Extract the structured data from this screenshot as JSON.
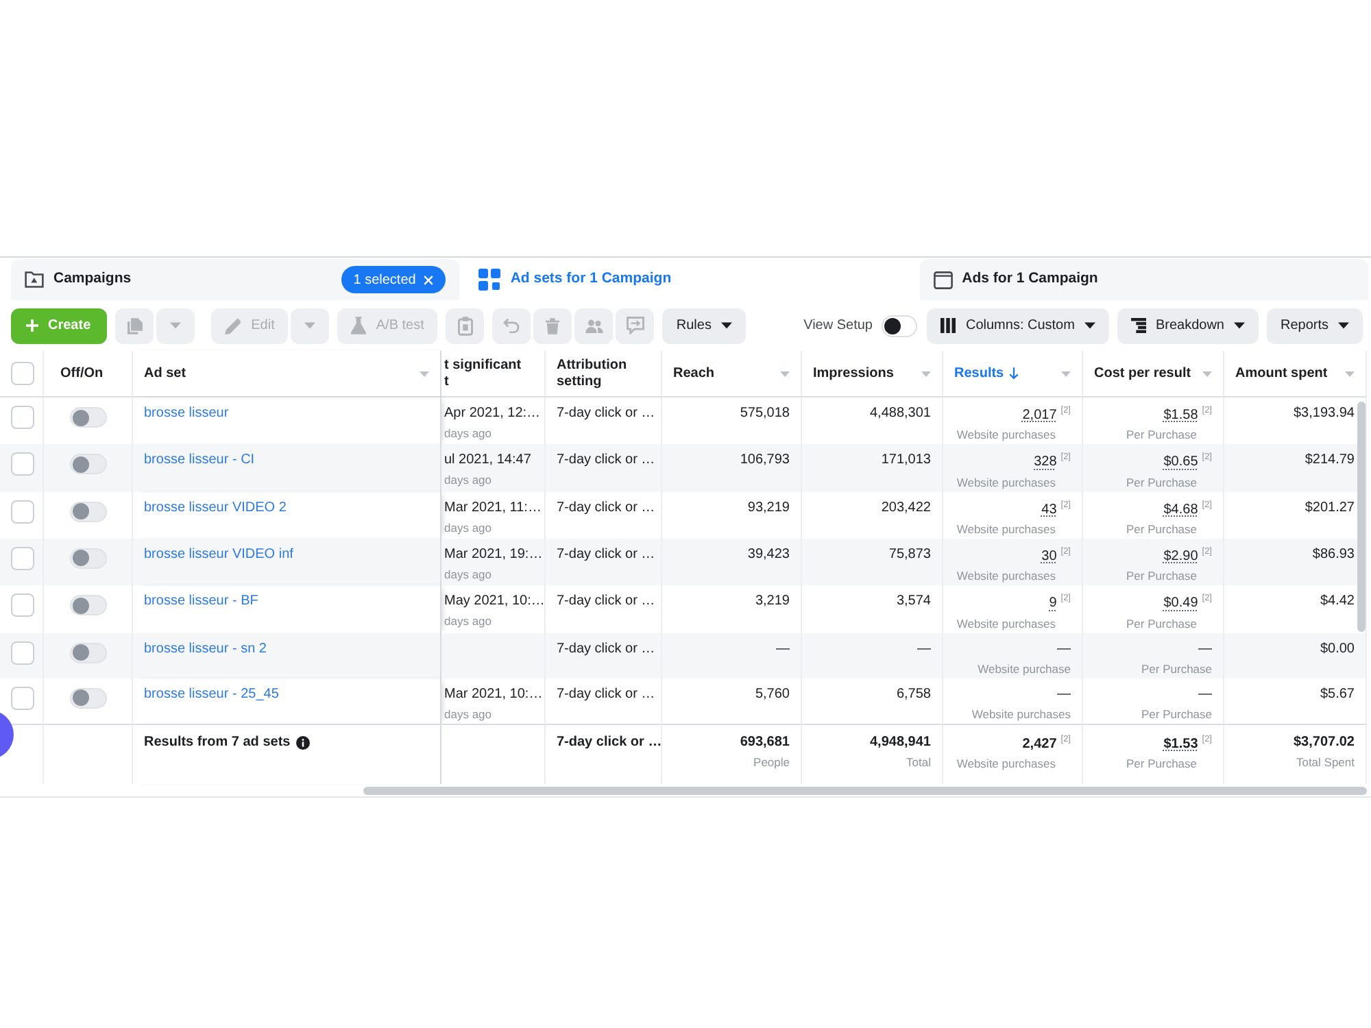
{
  "tabs": [
    {
      "kind": "campaigns",
      "label": "Campaigns",
      "selected": false,
      "chip": "1 selected"
    },
    {
      "kind": "ad_sets",
      "label": "Ad sets for 1 Campaign",
      "selected": true
    },
    {
      "kind": "ads",
      "label": "Ads for 1 Campaign",
      "selected": false
    }
  ],
  "toolbar": {
    "left": [
      [
        {
          "kind": "create",
          "label": "Create",
          "disabled": false
        }
      ],
      [
        {
          "kind": "duplicate",
          "disabled": true,
          "split_menu": true
        }
      ],
      [
        {
          "kind": "edit",
          "label": "Edit",
          "disabled": true,
          "split_menu": true
        }
      ],
      [
        {
          "kind": "ab_test",
          "label": "A/B test",
          "disabled": true
        }
      ],
      [
        {
          "kind": "clipboard",
          "disabled": true
        }
      ],
      [
        {
          "kind": "undo",
          "disabled": true
        },
        {
          "kind": "delete",
          "disabled": true
        },
        {
          "kind": "people",
          "disabled": true
        },
        {
          "kind": "bubble",
          "disabled": true
        }
      ],
      [
        {
          "kind": "rules",
          "label": "Rules",
          "disabled": false,
          "menu": true
        }
      ]
    ],
    "right": [
      {
        "kind": "view_setup",
        "label": "View Setup",
        "on": false
      },
      {
        "kind": "columns",
        "label": "Columns: Custom",
        "disabled": false,
        "menu": true
      },
      {
        "kind": "breakdown",
        "label": "Breakdown",
        "disabled": false,
        "menu": true
      },
      {
        "kind": "reports",
        "label": "Reports",
        "disabled": false,
        "menu": true
      }
    ]
  },
  "table": {
    "select_all": {
      "checked": false
    },
    "columns": [
      {
        "label": "Off/On",
        "menu": false,
        "sorted": false
      },
      {
        "label": "Ad set",
        "menu": true,
        "sorted": false
      },
      {
        "label": "t significant\nt",
        "menu": false,
        "sorted": false
      },
      {
        "label": "Attribution setting",
        "menu": false,
        "sorted": false
      },
      {
        "label": "Reach",
        "menu": true,
        "sorted": false
      },
      {
        "label": "Impressions",
        "menu": true,
        "sorted": false
      },
      {
        "label": "Results",
        "menu": true,
        "sorted": true
      },
      {
        "label": "Cost per result",
        "menu": true,
        "sorted": false
      },
      {
        "label": "Amount spent",
        "menu": true,
        "sorted": false
      }
    ],
    "rows": [
      {
        "selected": false,
        "on": false,
        "name": "brosse lisseur",
        "last_edit": "Apr 2021, 12:…",
        "last_edit_ago": "days ago",
        "attribution": "7-day click or …",
        "reach": "575,018",
        "impressions": "4,488,301",
        "results": {
          "value": "2,017",
          "note": "[2]",
          "label": "Website purchases",
          "underline": true
        },
        "cost_per_result": {
          "value": "$1.58",
          "note": "[2]",
          "label": "Per Purchase",
          "underline": true
        },
        "amount_spent": "$3,193.94"
      },
      {
        "selected": false,
        "on": false,
        "name": "brosse lisseur - CI",
        "last_edit": "ul 2021, 14:47",
        "last_edit_ago": "days ago",
        "attribution": "7-day click or …",
        "reach": "106,793",
        "impressions": "171,013",
        "results": {
          "value": "328",
          "note": "[2]",
          "label": "Website purchases",
          "underline": true
        },
        "cost_per_result": {
          "value": "$0.65",
          "note": "[2]",
          "label": "Per Purchase",
          "underline": true
        },
        "amount_spent": "$214.79"
      },
      {
        "selected": false,
        "on": false,
        "name": "brosse lisseur VIDEO 2",
        "last_edit": "Mar 2021, 11:…",
        "last_edit_ago": "days ago",
        "attribution": "7-day click or …",
        "reach": "93,219",
        "impressions": "203,422",
        "results": {
          "value": "43",
          "note": "[2]",
          "label": "Website purchases",
          "underline": true
        },
        "cost_per_result": {
          "value": "$4.68",
          "note": "[2]",
          "label": "Per Purchase",
          "underline": true
        },
        "amount_spent": "$201.27"
      },
      {
        "selected": false,
        "on": false,
        "name": "brosse lisseur VIDEO inf",
        "last_edit": "Mar 2021, 19:…",
        "last_edit_ago": "days ago",
        "attribution": "7-day click or …",
        "reach": "39,423",
        "impressions": "75,873",
        "results": {
          "value": "30",
          "note": "[2]",
          "label": "Website purchases",
          "underline": true
        },
        "cost_per_result": {
          "value": "$2.90",
          "note": "[2]",
          "label": "Per Purchase",
          "underline": true
        },
        "amount_spent": "$86.93"
      },
      {
        "selected": false,
        "on": false,
        "name": "brosse lisseur - BF",
        "last_edit": "May 2021, 10:…",
        "last_edit_ago": "days ago",
        "attribution": "7-day click or …",
        "reach": "3,219",
        "impressions": "3,574",
        "results": {
          "value": "9",
          "note": "[2]",
          "label": "Website purchases",
          "underline": true
        },
        "cost_per_result": {
          "value": "$0.49",
          "note": "[2]",
          "label": "Per Purchase",
          "underline": true
        },
        "amount_spent": "$4.42"
      },
      {
        "selected": false,
        "on": false,
        "name": "brosse lisseur - sn 2",
        "attribution": "7-day click or …",
        "reach": "—",
        "impressions": "—",
        "results": {
          "value": "—",
          "label": "Website purchase",
          "underline": false
        },
        "cost_per_result": {
          "value": "—",
          "label": "Per Purchase",
          "underline": false
        },
        "amount_spent": "$0.00"
      },
      {
        "selected": false,
        "on": false,
        "name": "brosse lisseur - 25_45",
        "last_edit": "Mar 2021, 10:…",
        "last_edit_ago": "days ago",
        "attribution": "7-day click or …",
        "reach": "5,760",
        "impressions": "6,758",
        "results": {
          "value": "—",
          "label": "Website purchases",
          "underline": false
        },
        "cost_per_result": {
          "value": "—",
          "label": "Per Purchase",
          "underline": false
        },
        "amount_spent": "$5.67"
      }
    ],
    "summary": {
      "label": "Results from 7 ad sets",
      "attribution": "7-day click or …",
      "reach": {
        "value": "693,681",
        "label": "People"
      },
      "impressions": {
        "value": "4,948,941",
        "label": "Total"
      },
      "results": {
        "value": "2,427",
        "note": "[2]",
        "label": "Website purchases",
        "underline": false
      },
      "cost_per_result": {
        "value": "$1.53",
        "note": "[2]",
        "label": "Per Purchase",
        "underline": true
      },
      "amount_spent": {
        "value": "$3,707.02",
        "label": "Total Spent"
      }
    }
  }
}
